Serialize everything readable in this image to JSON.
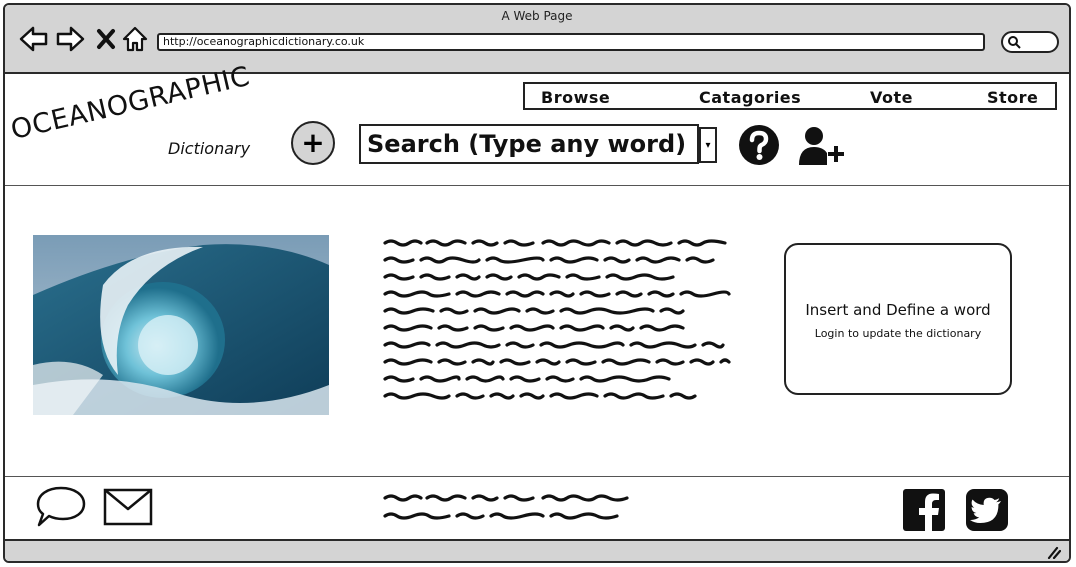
{
  "window": {
    "title": "A Web Page"
  },
  "browser": {
    "url": "http://oceanographicdictionary.co.uk",
    "back_icon": "arrow-left-icon",
    "forward_icon": "arrow-right-icon",
    "close_icon": "x-icon",
    "home_icon": "home-icon",
    "search_icon": "magnifier-icon"
  },
  "logo": {
    "main": "OCEANOGRAPHIC",
    "sub": "Dictionary"
  },
  "header": {
    "add_button_label": "+",
    "search_placeholder": "Search (Type any word)",
    "dropdown_glyph": "▾",
    "help_icon": "question-circle-icon",
    "add_user_icon": "user-plus-icon"
  },
  "nav": {
    "items": [
      {
        "label": "Browse"
      },
      {
        "label": "Catagories"
      },
      {
        "label": "Vote"
      },
      {
        "label": "Store"
      }
    ]
  },
  "hero": {
    "image": "ocean-wave-image"
  },
  "insert_box": {
    "title": "Insert and Define a word",
    "subtitle": "Login to update the dictionary"
  },
  "footer": {
    "chat_icon": "speech-bubble-icon",
    "mail_icon": "envelope-icon",
    "facebook_icon": "facebook-icon",
    "twitter_icon": "twitter-icon"
  },
  "colors": {
    "chrome": "#d4d4d4",
    "stroke": "#222222"
  }
}
